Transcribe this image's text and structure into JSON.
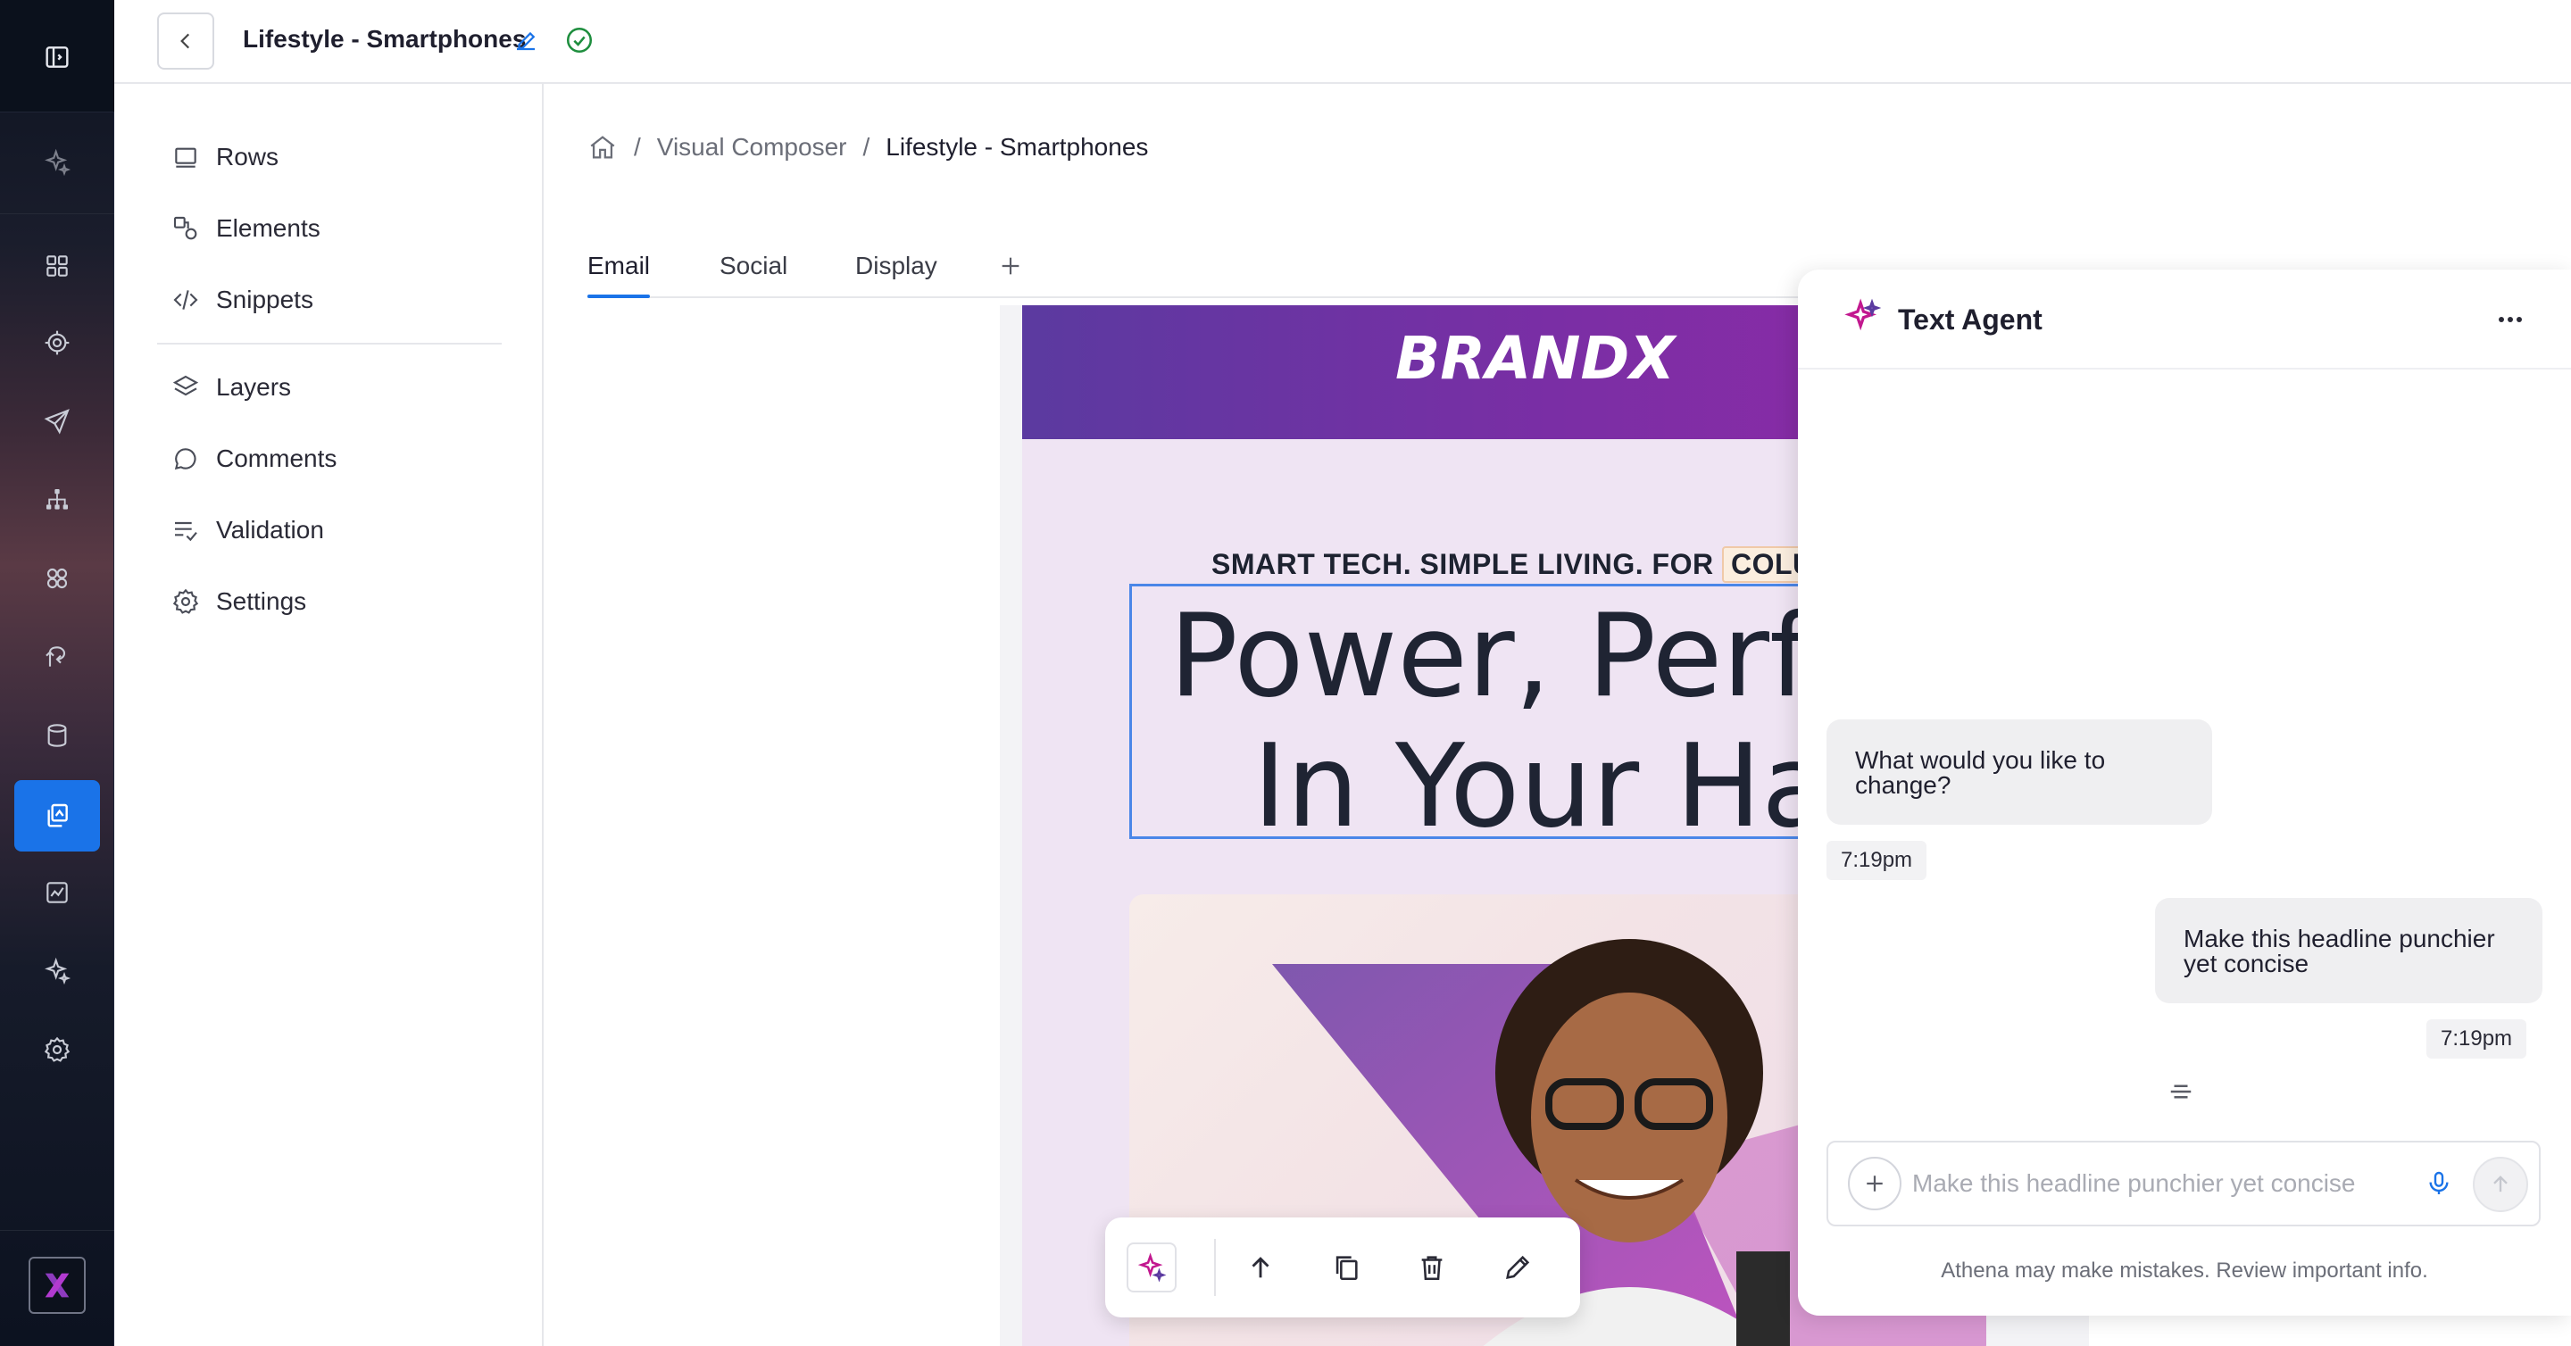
{
  "header": {
    "title": "Lifestyle - Smartphones",
    "back_icon": "chevron-left-icon",
    "status": "saved"
  },
  "rail": {
    "items": [
      "panel-toggle-icon",
      "ai-sparkle-icon",
      "dashboard-icon",
      "target-icon",
      "send-icon",
      "hierarchy-icon",
      "segments-icon",
      "journey-icon",
      "database-icon",
      "visual-composer-icon",
      "analytics-icon",
      "sparkle-icon",
      "settings-icon"
    ],
    "active": "visual-composer-icon",
    "accent": "#1a73e8"
  },
  "panel": {
    "items": [
      {
        "label": "Rows",
        "icon": "rows-icon"
      },
      {
        "label": "Elements",
        "icon": "elements-icon"
      },
      {
        "label": "Snippets",
        "icon": "code-icon"
      },
      {
        "label": "Layers",
        "icon": "layers-icon"
      },
      {
        "label": "Comments",
        "icon": "comment-icon"
      },
      {
        "label": "Validation",
        "icon": "validation-icon"
      },
      {
        "label": "Settings",
        "icon": "gear-icon"
      }
    ]
  },
  "breadcrumb": {
    "items": [
      "Visual Composer",
      "Lifestyle - Smartphones"
    ],
    "separator": "/"
  },
  "tabs": {
    "items": [
      "Email",
      "Social",
      "Display"
    ],
    "active": "Email"
  },
  "email": {
    "brand": "BRANDX",
    "eyebrow": "SMART TECH. SIMPLE LIVING. FOR",
    "eyebrow_tag": "COLU",
    "headline_line1": "Power, Perfect",
    "headline_line2": "In Your Han",
    "header_color": "#7a2ea5"
  },
  "agent": {
    "title": "Text Agent",
    "messages": [
      {
        "role": "agent",
        "text": "What would you like to change?",
        "time": "7:19pm"
      },
      {
        "role": "user",
        "text": "Make this headline punchier yet concise",
        "time": "7:19pm"
      }
    ],
    "input_placeholder": "Make this headline punchier yet concise",
    "disclaimer": "Athena may make mistakes. Review important info."
  }
}
